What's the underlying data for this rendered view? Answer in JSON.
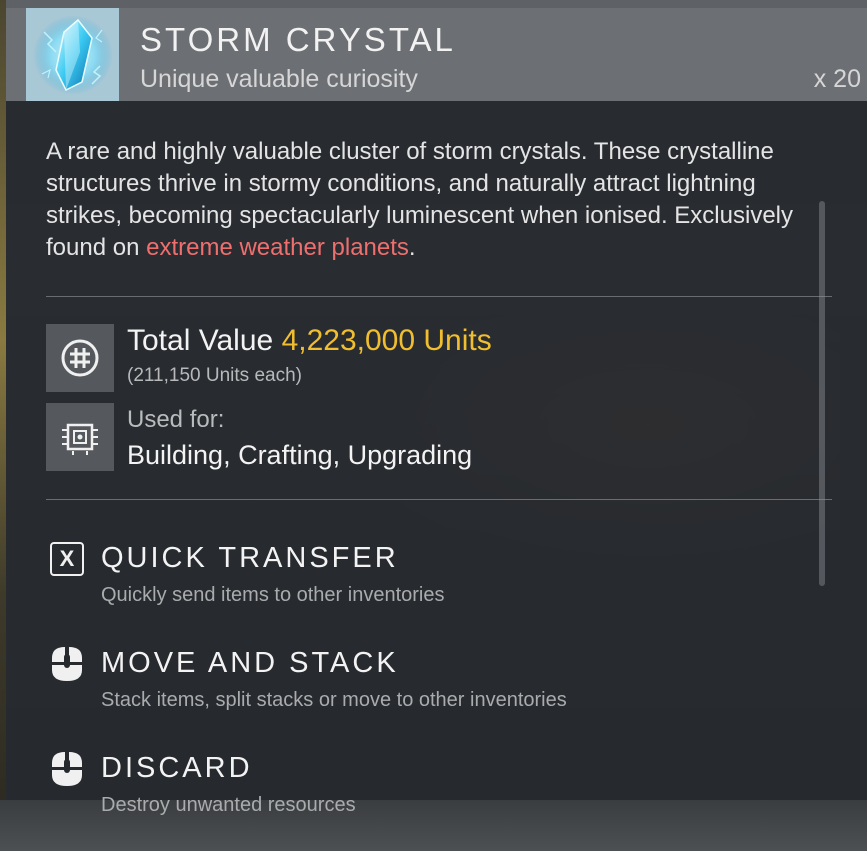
{
  "item": {
    "name": "STORM CRYSTAL",
    "category": "Unique valuable curiosity",
    "quantity": "x 20",
    "icon": "storm-crystal-icon",
    "description_parts": {
      "before": "A rare and highly valuable cluster of storm crystals. These crystalline structures thrive in stormy conditions, and naturally attract lightning strikes, becoming spectacularly luminescent when ionised. Exclusively found on ",
      "highlight": "extreme weather planets",
      "after": "."
    }
  },
  "stats": {
    "value_label": "Total Value",
    "value_amount": "4,223,000 Units",
    "each": "(211,150 Units each)",
    "value_icon": "units-currency-icon",
    "used_for_label": "Used for:",
    "used_for_value": "Building, Crafting, Upgrading",
    "used_for_icon": "chip-icon"
  },
  "actions": [
    {
      "key": "X",
      "title": "QUICK TRANSFER",
      "desc": "Quickly send items to other inventories",
      "icon": "x-key-icon"
    },
    {
      "title": "MOVE AND STACK",
      "desc": "Stack items, split stacks or move to other inventories",
      "icon": "mouse-left-click-icon"
    },
    {
      "title": "DISCARD",
      "desc": "Destroy unwanted resources",
      "icon": "mouse-left-click-icon"
    }
  ],
  "colors": {
    "accent_gold": "#f0be2e",
    "highlight_red": "#ef6f6f",
    "header_bg": "#6c6f73"
  }
}
